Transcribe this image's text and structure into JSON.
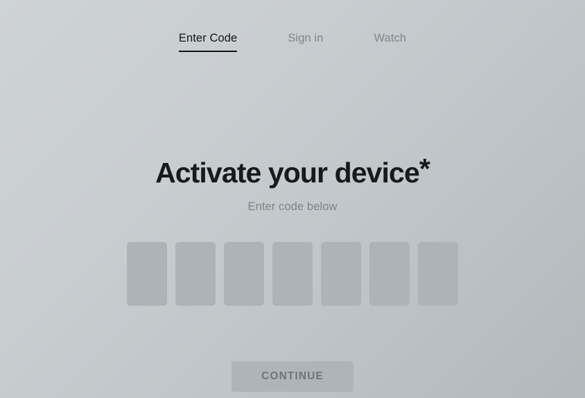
{
  "page": {
    "background_top_color": "#ced3d5",
    "background_bottom_color": "#b2b8bb"
  },
  "nav": {
    "items": [
      {
        "label": "Enter Code",
        "active": true
      },
      {
        "label": "Sign in",
        "active": false
      },
      {
        "label": "Watch",
        "active": false
      }
    ]
  },
  "main": {
    "title": "Activate your device",
    "title_suffix": "*",
    "subtitle": "Enter code below",
    "code_input": {
      "length": 7,
      "placeholder": "",
      "values": [
        "",
        "",
        "",
        "",
        "",
        "",
        ""
      ]
    },
    "continue_button": {
      "label": "CONTINUE",
      "disabled": true,
      "fill_color": "#aeb4b7",
      "text_color": "#6e7477"
    }
  }
}
